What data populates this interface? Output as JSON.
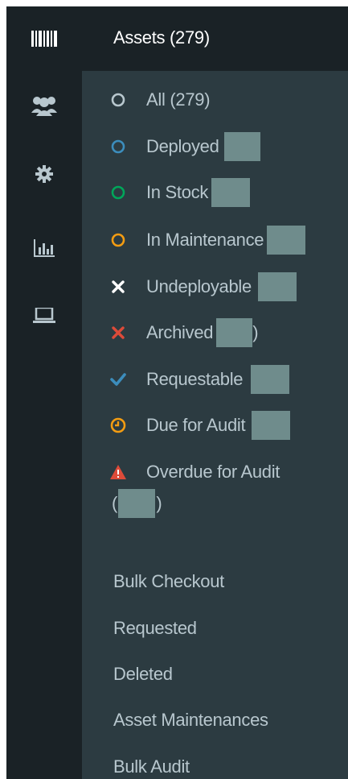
{
  "header": {
    "title": "Assets (279)"
  },
  "icon_sidebar": {
    "icons": [
      "barcode-icon",
      "users-icon",
      "gear-icon",
      "bar-chart-icon",
      "laptop-icon"
    ]
  },
  "asset_filters": [
    {
      "label": "All (279)",
      "icon": "circle-outline-icon",
      "color": "#b8c7ce"
    },
    {
      "label": "Deployed (",
      "icon": "circle-outline-icon",
      "color": "#3c8dbc"
    },
    {
      "label": "In Stock",
      "icon": "circle-outline-icon",
      "color": "#00a65a"
    },
    {
      "label": "In Maintenance",
      "icon": "circle-outline-icon",
      "color": "#f39c12"
    },
    {
      "label": "Undeployable",
      "icon": "times-icon",
      "color": "#ffffff"
    },
    {
      "label": "Archived",
      "icon": "times-icon",
      "color": "#dd4b39"
    },
    {
      "label": "Requestable",
      "icon": "check-icon",
      "color": "#3c8dbc"
    },
    {
      "label": "Due for Audit",
      "icon": "clock-icon",
      "color": "#f39c12"
    },
    {
      "label": "Overdue for Audit",
      "icon": "warning-icon",
      "color": "#dd4b39"
    }
  ],
  "archived_suffix": ")",
  "overdue_open": "(",
  "overdue_close": ")",
  "links": [
    "Bulk Checkout",
    "Requested",
    "Deleted",
    "Asset Maintenances",
    "Bulk Audit"
  ]
}
